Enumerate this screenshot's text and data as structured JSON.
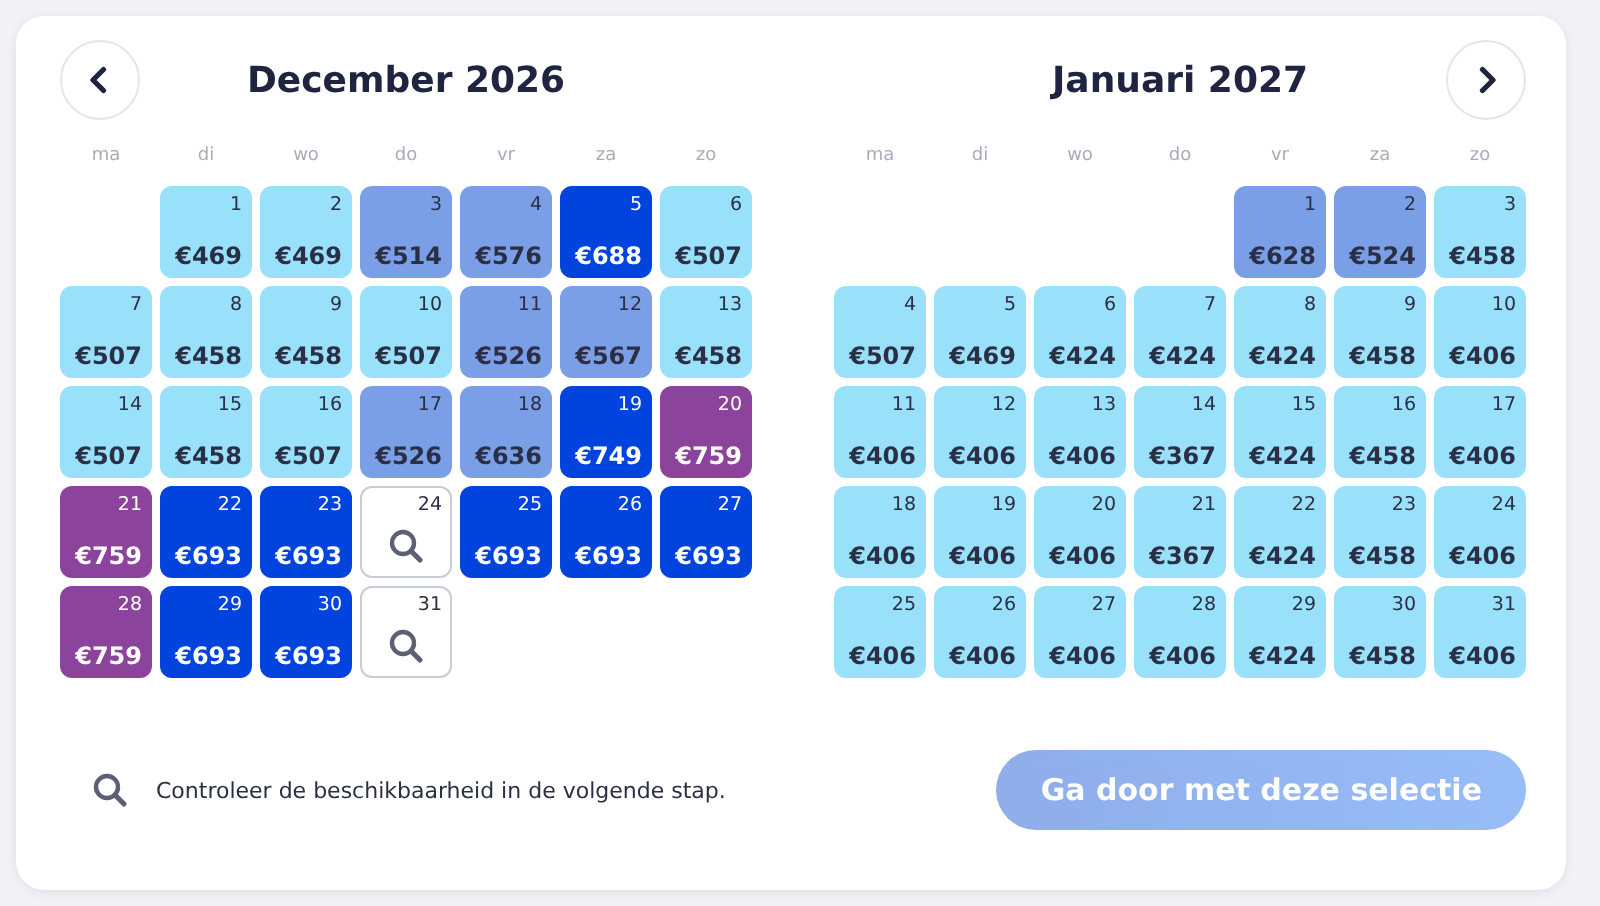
{
  "months": [
    {
      "title": "December 2026",
      "nav": {
        "kind": "prev"
      },
      "weekdays": [
        "ma",
        "di",
        "wo",
        "do",
        "vr",
        "za",
        "zo"
      ],
      "days": [
        {
          "kind": "blank"
        },
        {
          "kind": "price",
          "day": "1",
          "price": "€469",
          "color": "#99e0fb"
        },
        {
          "kind": "price",
          "day": "2",
          "price": "€469",
          "color": "#99e0fb"
        },
        {
          "kind": "price",
          "day": "3",
          "price": "€514",
          "color": "#7b9fe6"
        },
        {
          "kind": "price",
          "day": "4",
          "price": "€576",
          "color": "#7b9fe6"
        },
        {
          "kind": "price",
          "day": "5",
          "price": "€688",
          "color": "#0043dd"
        },
        {
          "kind": "price",
          "day": "6",
          "price": "€507",
          "color": "#99e0fb"
        },
        {
          "kind": "price",
          "day": "7",
          "price": "€507",
          "color": "#99e0fb"
        },
        {
          "kind": "price",
          "day": "8",
          "price": "€458",
          "color": "#99e0fb"
        },
        {
          "kind": "price",
          "day": "9",
          "price": "€458",
          "color": "#99e0fb"
        },
        {
          "kind": "price",
          "day": "10",
          "price": "€507",
          "color": "#99e0fb"
        },
        {
          "kind": "price",
          "day": "11",
          "price": "€526",
          "color": "#7b9fe6"
        },
        {
          "kind": "price",
          "day": "12",
          "price": "€567",
          "color": "#7b9fe6"
        },
        {
          "kind": "price",
          "day": "13",
          "price": "€458",
          "color": "#99e0fb"
        },
        {
          "kind": "price",
          "day": "14",
          "price": "€507",
          "color": "#99e0fb"
        },
        {
          "kind": "price",
          "day": "15",
          "price": "€458",
          "color": "#99e0fb"
        },
        {
          "kind": "price",
          "day": "16",
          "price": "€507",
          "color": "#99e0fb"
        },
        {
          "kind": "price",
          "day": "17",
          "price": "€526",
          "color": "#7b9fe6"
        },
        {
          "kind": "price",
          "day": "18",
          "price": "€636",
          "color": "#7b9fe6"
        },
        {
          "kind": "price",
          "day": "19",
          "price": "€749",
          "color": "#0043dd"
        },
        {
          "kind": "price",
          "day": "20",
          "price": "€759",
          "color": "#8c439c"
        },
        {
          "kind": "price",
          "day": "21",
          "price": "€759",
          "color": "#8c439c"
        },
        {
          "kind": "price",
          "day": "22",
          "price": "€693",
          "color": "#0043dd"
        },
        {
          "kind": "price",
          "day": "23",
          "price": "€693",
          "color": "#0043dd"
        },
        {
          "kind": "check",
          "day": "24"
        },
        {
          "kind": "price",
          "day": "25",
          "price": "€693",
          "color": "#0043dd"
        },
        {
          "kind": "price",
          "day": "26",
          "price": "€693",
          "color": "#0043dd"
        },
        {
          "kind": "price",
          "day": "27",
          "price": "€693",
          "color": "#0043dd"
        },
        {
          "kind": "price",
          "day": "28",
          "price": "€759",
          "color": "#8c439c"
        },
        {
          "kind": "price",
          "day": "29",
          "price": "€693",
          "color": "#0043dd"
        },
        {
          "kind": "price",
          "day": "30",
          "price": "€693",
          "color": "#0043dd"
        },
        {
          "kind": "check",
          "day": "31"
        }
      ]
    },
    {
      "title": "Januari 2027",
      "nav": {
        "kind": "next"
      },
      "weekdays": [
        "ma",
        "di",
        "wo",
        "do",
        "vr",
        "za",
        "zo"
      ],
      "days": [
        {
          "kind": "blank"
        },
        {
          "kind": "blank"
        },
        {
          "kind": "blank"
        },
        {
          "kind": "blank"
        },
        {
          "kind": "price",
          "day": "1",
          "price": "€628",
          "color": "#7b9fe6"
        },
        {
          "kind": "price",
          "day": "2",
          "price": "€524",
          "color": "#7b9fe6"
        },
        {
          "kind": "price",
          "day": "3",
          "price": "€458",
          "color": "#99e0fb"
        },
        {
          "kind": "price",
          "day": "4",
          "price": "€507",
          "color": "#99e0fb"
        },
        {
          "kind": "price",
          "day": "5",
          "price": "€469",
          "color": "#99e0fb"
        },
        {
          "kind": "price",
          "day": "6",
          "price": "€424",
          "color": "#99e0fb"
        },
        {
          "kind": "price",
          "day": "7",
          "price": "€424",
          "color": "#99e0fb"
        },
        {
          "kind": "price",
          "day": "8",
          "price": "€424",
          "color": "#99e0fb"
        },
        {
          "kind": "price",
          "day": "9",
          "price": "€458",
          "color": "#99e0fb"
        },
        {
          "kind": "price",
          "day": "10",
          "price": "€406",
          "color": "#99e0fb"
        },
        {
          "kind": "price",
          "day": "11",
          "price": "€406",
          "color": "#99e0fb"
        },
        {
          "kind": "price",
          "day": "12",
          "price": "€406",
          "color": "#99e0fb"
        },
        {
          "kind": "price",
          "day": "13",
          "price": "€406",
          "color": "#99e0fb"
        },
        {
          "kind": "price",
          "day": "14",
          "price": "€367",
          "color": "#99e0fb"
        },
        {
          "kind": "price",
          "day": "15",
          "price": "€424",
          "color": "#99e0fb"
        },
        {
          "kind": "price",
          "day": "16",
          "price": "€458",
          "color": "#99e0fb"
        },
        {
          "kind": "price",
          "day": "17",
          "price": "€406",
          "color": "#99e0fb"
        },
        {
          "kind": "price",
          "day": "18",
          "price": "€406",
          "color": "#99e0fb"
        },
        {
          "kind": "price",
          "day": "19",
          "price": "€406",
          "color": "#99e0fb"
        },
        {
          "kind": "price",
          "day": "20",
          "price": "€406",
          "color": "#99e0fb"
        },
        {
          "kind": "price",
          "day": "21",
          "price": "€367",
          "color": "#99e0fb"
        },
        {
          "kind": "price",
          "day": "22",
          "price": "€424",
          "color": "#99e0fb"
        },
        {
          "kind": "price",
          "day": "23",
          "price": "€458",
          "color": "#99e0fb"
        },
        {
          "kind": "price",
          "day": "24",
          "price": "€406",
          "color": "#99e0fb"
        },
        {
          "kind": "price",
          "day": "25",
          "price": "€406",
          "color": "#99e0fb"
        },
        {
          "kind": "price",
          "day": "26",
          "price": "€406",
          "color": "#99e0fb"
        },
        {
          "kind": "price",
          "day": "27",
          "price": "€406",
          "color": "#99e0fb"
        },
        {
          "kind": "price",
          "day": "28",
          "price": "€406",
          "color": "#99e0fb"
        },
        {
          "kind": "price",
          "day": "29",
          "price": "€424",
          "color": "#99e0fb"
        },
        {
          "kind": "price",
          "day": "30",
          "price": "€458",
          "color": "#99e0fb"
        },
        {
          "kind": "price",
          "day": "31",
          "price": "€406",
          "color": "#99e0fb"
        }
      ]
    }
  ],
  "footer": {
    "note": "Controleer de beschikbaarheid in de volgende stap.",
    "button": {
      "label": "Ga door met deze selectie",
      "disabled": true
    }
  }
}
